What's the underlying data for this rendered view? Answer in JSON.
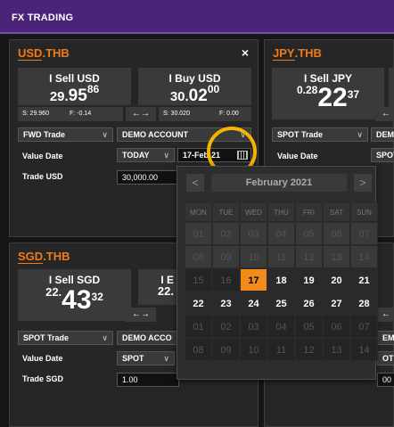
{
  "app": {
    "title": "FX TRADING"
  },
  "usd": {
    "pair": "USD",
    "pair_sep": ".",
    "pair_quote": "THB",
    "close": "×",
    "sell": {
      "label": "I Sell USD",
      "big": "29.",
      "mid": "95",
      "pip": "86"
    },
    "buy": {
      "label": "I Buy USD",
      "big": "30.",
      "mid": "02",
      "pip": "00"
    },
    "s_sell": "S: 29.960",
    "f_sell": "F: -0.14",
    "s_buy": "S: 30.020",
    "f_buy": "F: 0.00",
    "swap": "←→",
    "trade_type": "FWD Trade",
    "account": "DEMO ACCOUNT",
    "value_date_label": "Value Date",
    "value_date_mode": "TODAY",
    "value_date": "17-Feb-21",
    "trade_label": "Trade USD",
    "amount": "30,000.00"
  },
  "jpy": {
    "pair": "JPY",
    "pair_sep": ".",
    "pair_quote": "THB",
    "sell": {
      "label": "I Sell JPY",
      "big": "0.28",
      "mid": "22",
      "pip": "37"
    },
    "trade_type": "SPOT Trade",
    "account": "DEMO",
    "value_date_label": "Value Date",
    "value_date_mode": "SPOT"
  },
  "sgd": {
    "pair": "SGD",
    "pair_sep": ".",
    "pair_quote": "THB",
    "sell": {
      "label": "I Sell SGD",
      "big": "22.",
      "mid": "43",
      "pip": "32"
    },
    "buy": {
      "label": "I E",
      "big": "22."
    },
    "swap": "←→",
    "trade_type": "SPOT Trade",
    "account": "DEMO ACCO",
    "value_date_label": "Value Date",
    "value_date_mode": "SPOT",
    "trade_label": "Trade SGD",
    "amount": "1.00"
  },
  "calendar": {
    "month": "February 2021",
    "prev": "<",
    "next": ">",
    "weekdays": [
      "MON",
      "TUE",
      "WED",
      "THU",
      "FRI",
      "SAT",
      "SUN"
    ],
    "weeks": [
      [
        "01",
        "02",
        "03",
        "04",
        "05",
        "06",
        "07"
      ],
      [
        "08",
        "09",
        "10",
        "11",
        "12",
        "13",
        "14"
      ],
      [
        "15",
        "16",
        "17",
        "18",
        "19",
        "20",
        "21"
      ],
      [
        "22",
        "23",
        "24",
        "25",
        "26",
        "27",
        "28"
      ],
      [
        "01",
        "02",
        "03",
        "04",
        "05",
        "06",
        "07"
      ],
      [
        "08",
        "09",
        "10",
        "11",
        "12",
        "13",
        "14"
      ]
    ],
    "selected": "17"
  }
}
